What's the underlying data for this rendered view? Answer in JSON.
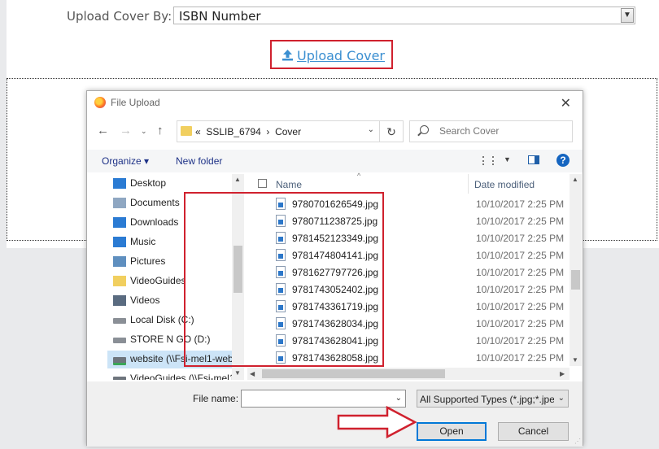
{
  "page": {
    "upload_by_label": "Upload Cover By:",
    "upload_by_value": "ISBN Number",
    "upload_cover_link": "Upload Cover"
  },
  "dialog": {
    "title": "File Upload",
    "close_glyph": "✕",
    "path": {
      "overflow": "«",
      "parts": [
        "SSLIB_6794",
        "Cover"
      ],
      "separator": "›"
    },
    "search_placeholder": "Search Cover",
    "toolbar": {
      "organize": "Organize ▾",
      "new_folder": "New folder",
      "help": "?"
    },
    "nav_items": [
      {
        "label": "Desktop",
        "icon": "desktop-icon"
      },
      {
        "label": "Documents",
        "icon": "documents-icon"
      },
      {
        "label": "Downloads",
        "icon": "downloads-icon"
      },
      {
        "label": "Music",
        "icon": "music-icon"
      },
      {
        "label": "Pictures",
        "icon": "pictures-icon"
      },
      {
        "label": "VideoGuides",
        "icon": "folder-icon"
      },
      {
        "label": "Videos",
        "icon": "videos-icon"
      },
      {
        "label": "Local Disk (C:)",
        "icon": "drive-icon"
      },
      {
        "label": "STORE N GO (D:)",
        "icon": "drive-icon"
      },
      {
        "label": "website (\\\\Fsi-mel1-web",
        "icon": "network-drive-icon",
        "selected": true
      },
      {
        "label": "VideoGuides (\\\\Fsi-mel1-",
        "icon": "network-drive-icon"
      }
    ],
    "columns": {
      "name": "Name",
      "date": "Date modified"
    },
    "files": [
      {
        "name": "9780701626549.jpg",
        "date": "10/10/2017 2:25 PM"
      },
      {
        "name": "9780711238725.jpg",
        "date": "10/10/2017 2:25 PM"
      },
      {
        "name": "9781452123349.jpg",
        "date": "10/10/2017 2:25 PM"
      },
      {
        "name": "9781474804141.jpg",
        "date": "10/10/2017 2:25 PM"
      },
      {
        "name": "9781627797726.jpg",
        "date": "10/10/2017 2:25 PM"
      },
      {
        "name": "9781743052402.jpg",
        "date": "10/10/2017 2:25 PM"
      },
      {
        "name": "9781743361719.jpg",
        "date": "10/10/2017 2:25 PM"
      },
      {
        "name": "9781743628034.jpg",
        "date": "10/10/2017 2:25 PM"
      },
      {
        "name": "9781743628041.jpg",
        "date": "10/10/2017 2:25 PM"
      },
      {
        "name": "9781743628058.jpg",
        "date": "10/10/2017 2:25 PM"
      }
    ],
    "file_name_label": "File name:",
    "file_name_value": "",
    "file_type": "All Supported Types (*.jpg;*.jpe",
    "open_button": "Open",
    "cancel_button": "Cancel"
  },
  "colors": {
    "annotation_red": "#d0212e",
    "link_blue": "#3b8fd1",
    "selection_blue": "#cce4f7"
  }
}
